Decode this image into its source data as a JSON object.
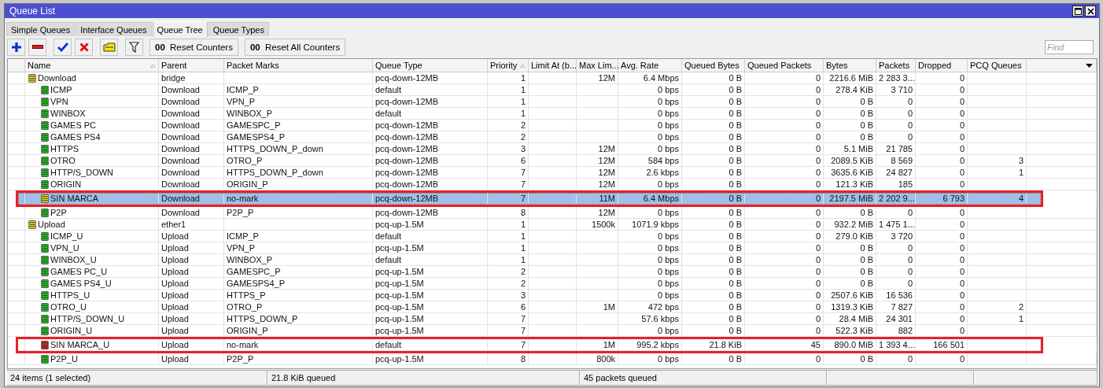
{
  "window": {
    "title": "Queue List"
  },
  "tabs": [
    {
      "label": "Simple Queues",
      "selected": false
    },
    {
      "label": "Interface Queues",
      "selected": false
    },
    {
      "label": "Queue Tree",
      "selected": true
    },
    {
      "label": "Queue Types",
      "selected": false
    }
  ],
  "toolbar": {
    "icon_buttons": [
      {
        "kind": "add"
      },
      {
        "kind": "remove"
      },
      {
        "kind": "enable"
      },
      {
        "kind": "disable"
      },
      {
        "kind": "comment"
      },
      {
        "kind": "filter"
      }
    ],
    "text_buttons": [
      {
        "icon_text": "00",
        "label": "Reset Counters"
      },
      {
        "icon_text": "00",
        "label": "Reset All Counters"
      }
    ],
    "search": {
      "placeholder": "Find"
    }
  },
  "tree": {
    "columns": [
      {
        "label": "Name",
        "sorted": true
      },
      {
        "label": "Parent",
        "sorted": false
      },
      {
        "label": "Packet Marks",
        "sorted": false
      },
      {
        "label": "Queue Type",
        "sorted": false
      },
      {
        "label": "Priority",
        "sorted": true
      },
      {
        "label": "Limit At (b...",
        "sorted": false
      },
      {
        "label": "Max Lim...",
        "sorted": false
      },
      {
        "label": "Avg. Rate",
        "sorted": false
      },
      {
        "label": "Queued Bytes",
        "sorted": false
      },
      {
        "label": "Queued Packets",
        "sorted": false
      },
      {
        "label": "Bytes",
        "sorted": false
      },
      {
        "label": "Packets",
        "sorted": false
      },
      {
        "label": "Dropped",
        "sorted": false
      },
      {
        "label": "PCQ Queues",
        "sorted": false
      }
    ],
    "rows": [
      {
        "color": "#f0e020",
        "selected": false,
        "annotated": false,
        "cells": [
          "Download",
          "bridge",
          null,
          "pcq-down-12MB",
          "1",
          null,
          "12M",
          "6.4 Mbps",
          "0 B",
          "0",
          "2216.6 MiB",
          "2 283 3...",
          "0",
          null
        ],
        "children": [
          {
            "color": "#22cc22",
            "selected": false,
            "annotated": false,
            "cells": [
              "ICMP",
              "Download",
              "ICMP_P",
              "default",
              "1",
              null,
              null,
              "0 bps",
              "0 B",
              "0",
              "278.4 KiB",
              "3 710",
              "0",
              null
            ]
          },
          {
            "color": "#22cc22",
            "selected": false,
            "annotated": false,
            "cells": [
              "VPN",
              "Download",
              "VPN_P",
              "pcq-down-12MB",
              "1",
              null,
              null,
              "0 bps",
              "0 B",
              "0",
              "0 B",
              "0",
              "0",
              null
            ]
          },
          {
            "color": "#22cc22",
            "selected": false,
            "annotated": false,
            "cells": [
              "WINBOX",
              "Download",
              "WINBOX_P",
              "default",
              "1",
              null,
              null,
              "0 bps",
              "0 B",
              "0",
              "0 B",
              "0",
              "0",
              null
            ]
          },
          {
            "color": "#22cc22",
            "selected": false,
            "annotated": false,
            "cells": [
              "GAMES PC",
              "Download",
              "GAMESPC_P",
              "pcq-down-12MB",
              "2",
              null,
              null,
              "0 bps",
              "0 B",
              "0",
              "0 B",
              "0",
              "0",
              null
            ]
          },
          {
            "color": "#22cc22",
            "selected": false,
            "annotated": false,
            "cells": [
              "GAMES PS4",
              "Download",
              "GAMESPS4_P",
              "pcq-down-12MB",
              "2",
              null,
              null,
              "0 bps",
              "0 B",
              "0",
              "0 B",
              "0",
              "0",
              null
            ]
          },
          {
            "color": "#22cc22",
            "selected": false,
            "annotated": false,
            "cells": [
              "HTTPS",
              "Download",
              "HTTPS_DOWN_P_down",
              "pcq-down-12MB",
              "3",
              null,
              "12M",
              "0 bps",
              "0 B",
              "0",
              "5.1 MiB",
              "21 785",
              "0",
              null
            ]
          },
          {
            "color": "#22cc22",
            "selected": false,
            "annotated": false,
            "cells": [
              "OTRO",
              "Download",
              "OTRO_P",
              "pcq-down-12MB",
              "6",
              null,
              "12M",
              "584 bps",
              "0 B",
              "0",
              "2089.5 KiB",
              "8 569",
              "0",
              "3"
            ]
          },
          {
            "color": "#22cc22",
            "selected": false,
            "annotated": false,
            "cells": [
              "HTTP/S_DOWN",
              "Download",
              "HTTPS_DOWN_P_down",
              "pcq-down-12MB",
              "7",
              null,
              "12M",
              "2.6 kbps",
              "0 B",
              "0",
              "3635.6 KiB",
              "24 827",
              "0",
              "1"
            ]
          },
          {
            "color": "#22cc22",
            "selected": false,
            "annotated": false,
            "cells": [
              "ORIGIN",
              "Download",
              "ORIGIN_P",
              "pcq-down-12MB",
              "7",
              null,
              "12M",
              "0 bps",
              "0 B",
              "0",
              "121.3 KiB",
              "185",
              "0",
              null
            ]
          },
          {
            "color": "#f0e020",
            "selected": true,
            "annotated": true,
            "cells": [
              "SIN MARCA",
              "Download",
              "no-mark",
              "pcq-down-12MB",
              "7",
              null,
              "11M",
              "6.4 Mbps",
              "0 B",
              "0",
              "2197.5 MiB",
              "2 202 9...",
              "6 793",
              "4"
            ]
          },
          {
            "color": "#22cc22",
            "selected": false,
            "annotated": false,
            "cells": [
              "P2P",
              "Download",
              "P2P_P",
              "pcq-down-12MB",
              "8",
              null,
              "12M",
              "0 bps",
              "0 B",
              "0",
              "0 B",
              "0",
              "0",
              null
            ]
          }
        ]
      },
      {
        "color": "#f0e020",
        "selected": false,
        "annotated": false,
        "cells": [
          "Upload",
          "ether1",
          null,
          "pcq-up-1.5M",
          "1",
          null,
          "1500k",
          "1071.9 kbps",
          "0 B",
          "0",
          "932.2 MiB",
          "1 475 1...",
          "0",
          null
        ],
        "children": [
          {
            "color": "#22cc22",
            "selected": false,
            "annotated": false,
            "cells": [
              "ICMP_U",
              "Upload",
              "ICMP_P",
              "default",
              "1",
              null,
              null,
              "0 bps",
              "0 B",
              "0",
              "279.0 KiB",
              "3 720",
              "0",
              null
            ]
          },
          {
            "color": "#22cc22",
            "selected": false,
            "annotated": false,
            "cells": [
              "VPN_U",
              "Upload",
              "VPN_P",
              "pcq-up-1.5M",
              "1",
              null,
              null,
              "0 bps",
              "0 B",
              "0",
              "0 B",
              "0",
              "0",
              null
            ]
          },
          {
            "color": "#22cc22",
            "selected": false,
            "annotated": false,
            "cells": [
              "WINBOX_U",
              "Upload",
              "WINBOX_P",
              "default",
              "1",
              null,
              null,
              "0 bps",
              "0 B",
              "0",
              "0 B",
              "0",
              "0",
              null
            ]
          },
          {
            "color": "#22cc22",
            "selected": false,
            "annotated": false,
            "cells": [
              "GAMES PC_U",
              "Upload",
              "GAMESPC_P",
              "pcq-up-1.5M",
              "2",
              null,
              null,
              "0 bps",
              "0 B",
              "0",
              "0 B",
              "0",
              "0",
              null
            ]
          },
          {
            "color": "#22cc22",
            "selected": false,
            "annotated": false,
            "cells": [
              "GAMES PS4_U",
              "Upload",
              "GAMESPS4_P",
              "pcq-up-1.5M",
              "2",
              null,
              null,
              "0 bps",
              "0 B",
              "0",
              "0 B",
              "0",
              "0",
              null
            ]
          },
          {
            "color": "#22cc22",
            "selected": false,
            "annotated": false,
            "cells": [
              "HTTPS_U",
              "Upload",
              "HTTPS_P",
              "pcq-up-1.5M",
              "3",
              null,
              null,
              "0 bps",
              "0 B",
              "0",
              "2507.6 KiB",
              "16 536",
              "0",
              null
            ]
          },
          {
            "color": "#22cc22",
            "selected": false,
            "annotated": false,
            "cells": [
              "OTRO_U",
              "Upload",
              "OTRO_P",
              "pcq-up-1.5M",
              "6",
              null,
              "1M",
              "472 bps",
              "0 B",
              "0",
              "1319.3 KiB",
              "7 827",
              "0",
              "2"
            ]
          },
          {
            "color": "#22cc22",
            "selected": false,
            "annotated": false,
            "cells": [
              "HTTP/S_DOWN_U",
              "Upload",
              "HTTPS_DOWN_P",
              "pcq-up-1.5M",
              "7",
              null,
              null,
              "57.6 kbps",
              "0 B",
              "0",
              "28.4 MiB",
              "24 301",
              "0",
              "1"
            ]
          },
          {
            "color": "#22cc22",
            "selected": false,
            "annotated": false,
            "cells": [
              "ORIGIN_U",
              "Upload",
              "ORIGIN_P",
              "pcq-up-1.5M",
              "7",
              null,
              null,
              "0 bps",
              "0 B",
              "0",
              "522.3 KiB",
              "882",
              "0",
              null
            ]
          },
          {
            "color": "#dd2222",
            "selected": false,
            "annotated": true,
            "cells": [
              "SIN MARCA_U",
              "Upload",
              "no-mark",
              "default",
              "7",
              null,
              "1M",
              "995.2 kbps",
              "21.8 KiB",
              "45",
              "890.0 MiB",
              "1 393 4...",
              "166 501",
              null
            ]
          },
          {
            "color": "#22cc22",
            "selected": false,
            "annotated": false,
            "cells": [
              "P2P_U",
              "Upload",
              "P2P_P",
              "pcq-up-1.5M",
              "8",
              null,
              "800k",
              "0 bps",
              "0 B",
              "0",
              "0 B",
              "0",
              "0",
              null
            ]
          }
        ]
      }
    ]
  },
  "status_bar": [
    "24 items (1 selected)",
    "21.8 KiB queued",
    "45 packets queued"
  ]
}
